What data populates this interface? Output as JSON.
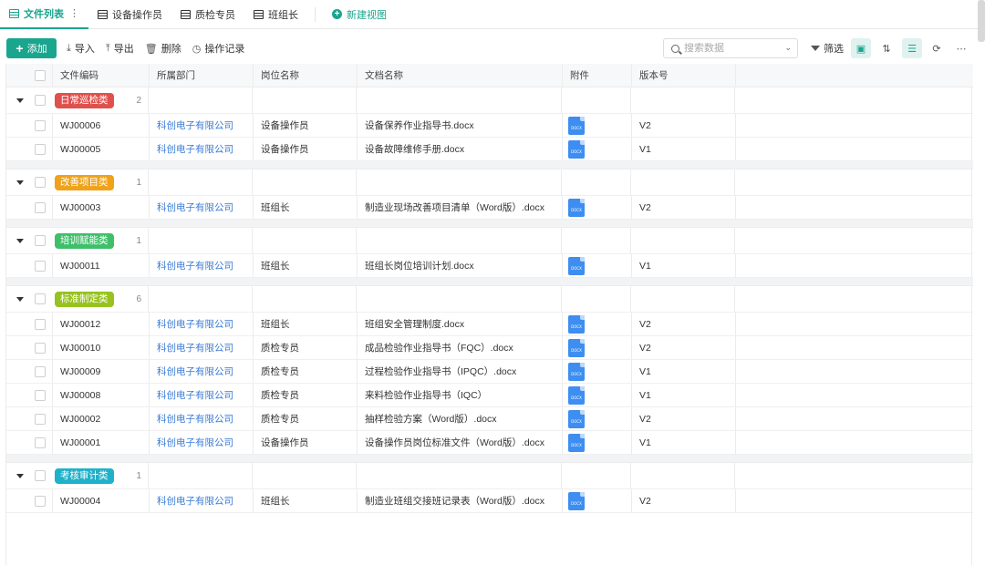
{
  "tabs": [
    {
      "label": "文件列表",
      "active": true
    },
    {
      "label": "设备操作员"
    },
    {
      "label": "质检专员"
    },
    {
      "label": "班组长"
    }
  ],
  "tab_menu": "⋮",
  "new_view": "新建视图",
  "toolbar": {
    "add": "添加",
    "import": "导入",
    "export": "导出",
    "delete": "删除",
    "log": "操作记录",
    "search_placeholder": "搜索数据",
    "filter": "筛选"
  },
  "columns": [
    "文件编码",
    "所属部门",
    "岗位名称",
    "文档名称",
    "附件",
    "版本号"
  ],
  "groups": [
    {
      "label": "日常巡检类",
      "color": "#e0504d",
      "count": "2",
      "rows": [
        {
          "code": "WJ00006",
          "dept": "科创电子有限公司",
          "post": "设备操作员",
          "doc": "设备保养作业指导书.docx",
          "att": "DOCX",
          "ver": "V2"
        },
        {
          "code": "WJ00005",
          "dept": "科创电子有限公司",
          "post": "设备操作员",
          "doc": "设备故障维修手册.docx",
          "att": "DOCX",
          "ver": "V1"
        }
      ]
    },
    {
      "label": "改善项目类",
      "color": "#f0a21a",
      "count": "1",
      "rows": [
        {
          "code": "WJ00003",
          "dept": "科创电子有限公司",
          "post": "班组长",
          "doc": "制造业现场改善项目清单（Word版）.docx",
          "att": "DOCX",
          "ver": "V2"
        }
      ]
    },
    {
      "label": "培训赋能类",
      "color": "#3fbf6a",
      "count": "1",
      "rows": [
        {
          "code": "WJ00011",
          "dept": "科创电子有限公司",
          "post": "班组长",
          "doc": "班组长岗位培训计划.docx",
          "att": "DOCX",
          "ver": "V1"
        }
      ]
    },
    {
      "label": "标准制定类",
      "color": "#97c21f",
      "count": "6",
      "rows": [
        {
          "code": "WJ00012",
          "dept": "科创电子有限公司",
          "post": "班组长",
          "doc": "班组安全管理制度.docx",
          "att": "DOCX",
          "ver": "V2"
        },
        {
          "code": "WJ00010",
          "dept": "科创电子有限公司",
          "post": "质检专员",
          "doc": "成品检验作业指导书（FQC）.docx",
          "att": "DOCX",
          "ver": "V2"
        },
        {
          "code": "WJ00009",
          "dept": "科创电子有限公司",
          "post": "质检专员",
          "doc": "过程检验作业指导书（IPQC）.docx",
          "att": "DOCX",
          "ver": "V1"
        },
        {
          "code": "WJ00008",
          "dept": "科创电子有限公司",
          "post": "质检专员",
          "doc": "来料检验作业指导书（IQC）",
          "att": "DOCX",
          "ver": "V1"
        },
        {
          "code": "WJ00002",
          "dept": "科创电子有限公司",
          "post": "质检专员",
          "doc": "抽样检验方案（Word版）.docx",
          "att": "DOCX",
          "ver": "V2"
        },
        {
          "code": "WJ00001",
          "dept": "科创电子有限公司",
          "post": "设备操作员",
          "doc": "设备操作员岗位标准文件（Word版）.docx",
          "att": "DOCX",
          "ver": "V1"
        }
      ]
    },
    {
      "label": "考核审计类",
      "color": "#1fb1c9",
      "count": "1",
      "rows": [
        {
          "code": "WJ00004",
          "dept": "科创电子有限公司",
          "post": "班组长",
          "doc": "制造业班组交接班记录表（Word版）.docx",
          "att": "DOCX",
          "ver": "V2"
        }
      ]
    }
  ]
}
